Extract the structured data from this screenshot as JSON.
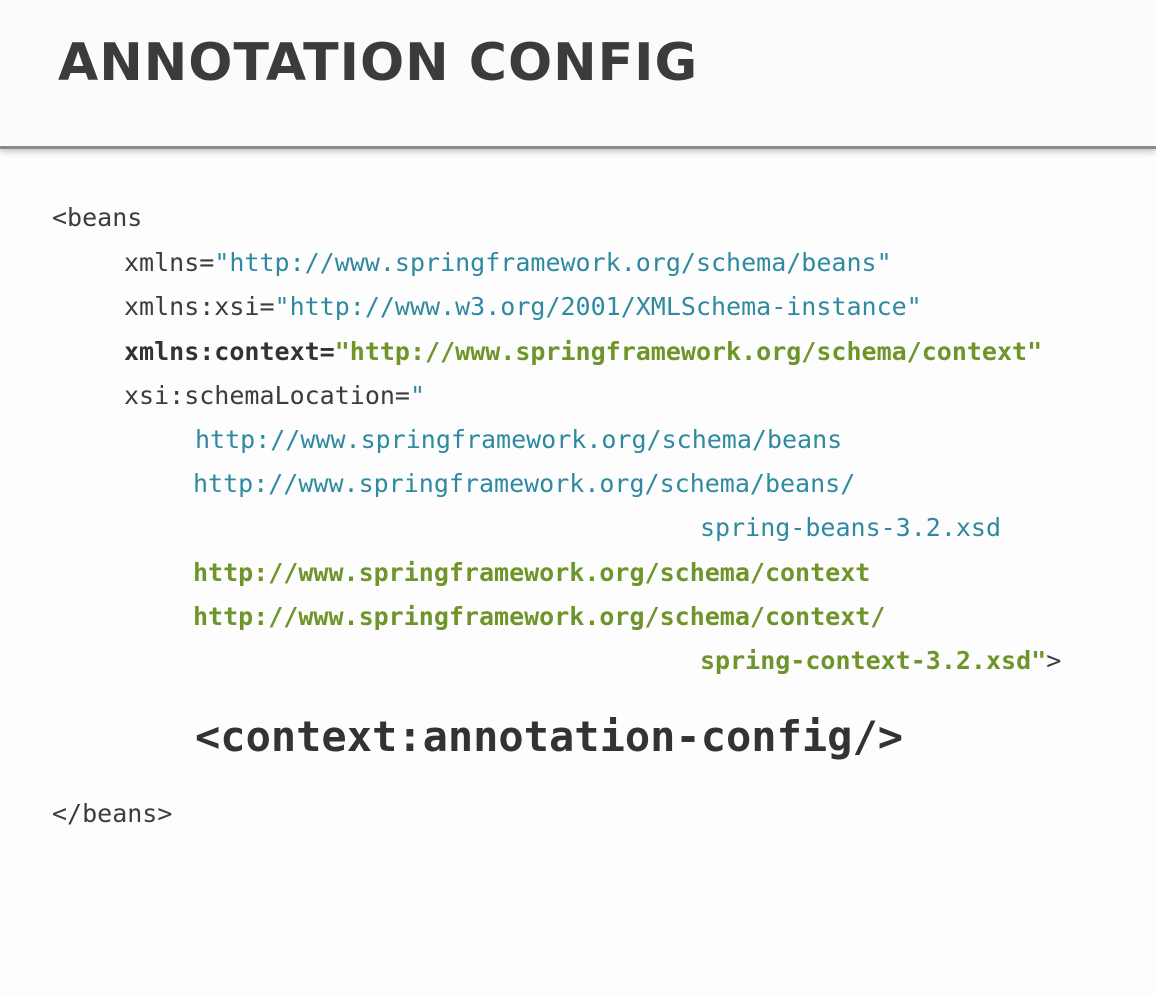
{
  "slide": {
    "title": "ANNOTATION CONFIG",
    "code": {
      "beans_open": "<beans",
      "xmlns_attr": "xmlns=",
      "xmlns_value": "\"http://www.springframework.org/schema/beans\"",
      "xsi_attr": "xmlns:xsi=",
      "xsi_value": "\"http://www.w3.org/2001/XMLSchema-instance\"",
      "context_attr": "xmlns:context=",
      "context_value": "\"http://www.springframework.org/schema/context\"",
      "schema_location_attr": "xsi:schemaLocation=",
      "schema_location_quote": "\"",
      "loc_beans_ns": "http://www.springframework.org/schema/beans",
      "loc_beans_xsd_path": "http://www.springframework.org/schema/beans/",
      "loc_beans_xsd_file": "spring-beans-3.2.xsd",
      "loc_context_ns": "http://www.springframework.org/schema/context",
      "loc_context_xsd_path": "http://www.springframework.org/schema/context/",
      "loc_context_xsd_file": "spring-context-3.2.xsd\"",
      "loc_close_bracket": ">",
      "annotation_config_tag": "<context:annotation-config/>",
      "beans_close": "</beans>"
    },
    "colors": {
      "title": "#3b3b3b",
      "plain_code": "#3c3c3c",
      "beans_schema": "#2f8aa0",
      "context_schema": "#6f952a"
    }
  }
}
